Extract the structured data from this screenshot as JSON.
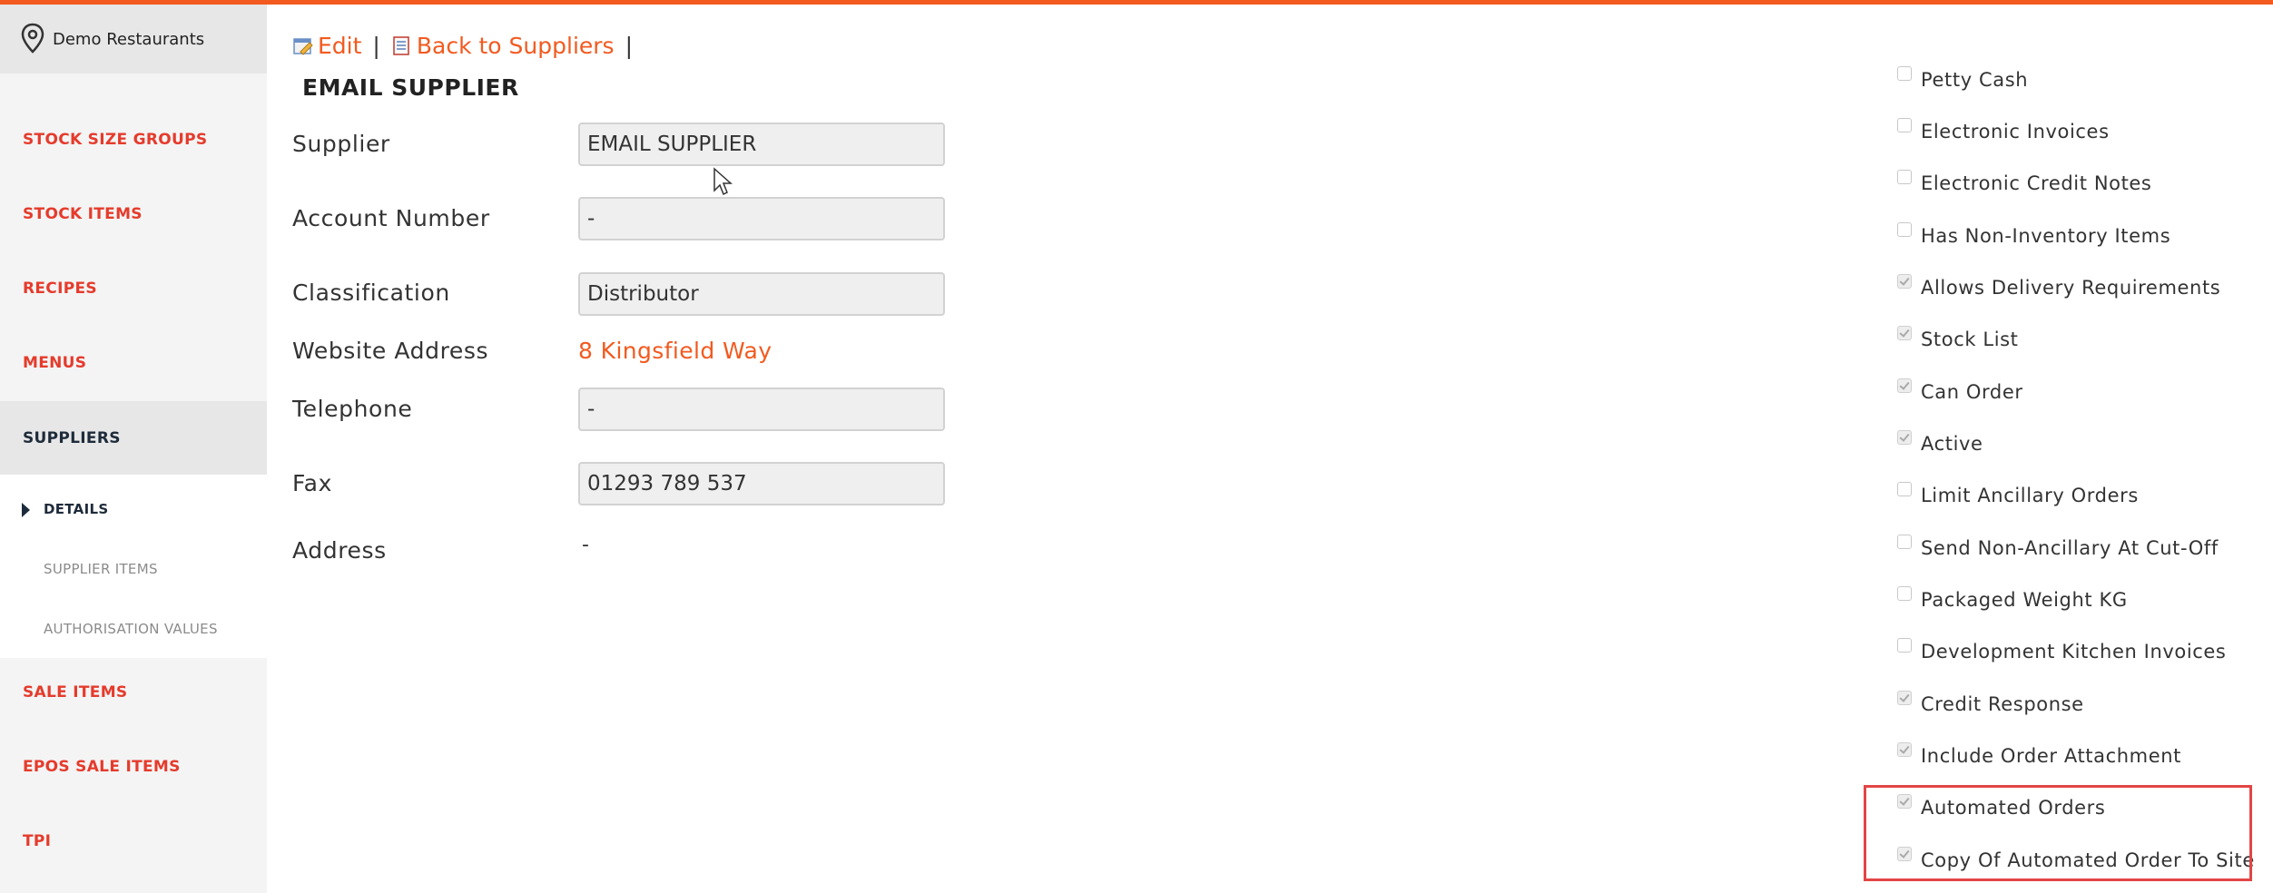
{
  "sidebar": {
    "restaurant_name": "Demo Restaurants",
    "items": [
      {
        "label": "STOCK SIZE GROUPS"
      },
      {
        "label": "STOCK ITEMS"
      },
      {
        "label": "RECIPES"
      },
      {
        "label": "MENUS"
      },
      {
        "label": "SUPPLIERS",
        "active": true
      },
      {
        "label": "SALE ITEMS"
      },
      {
        "label": "EPOS SALE ITEMS"
      },
      {
        "label": "TPI"
      }
    ],
    "subitems": [
      {
        "label": "DETAILS",
        "active": true
      },
      {
        "label": "SUPPLIER ITEMS"
      },
      {
        "label": "AUTHORISATION VALUES"
      }
    ]
  },
  "toolbar": {
    "edit_label": "Edit",
    "back_label": "Back to Suppliers",
    "separator": "|"
  },
  "page_title": "EMAIL SUPPLIER",
  "form": {
    "supplier": {
      "label": "Supplier",
      "value": "EMAIL SUPPLIER"
    },
    "account_number": {
      "label": "Account Number",
      "value": "-"
    },
    "classification": {
      "label": "Classification",
      "value": "Distributor"
    },
    "website": {
      "label": "Website Address",
      "value": "8 Kingsfield Way"
    },
    "telephone": {
      "label": "Telephone",
      "value": "-"
    },
    "fax": {
      "label": "Fax",
      "value": "01293 789 537"
    },
    "address": {
      "label": "Address",
      "value": "-"
    }
  },
  "options": [
    {
      "label": "Petty Cash",
      "checked": false
    },
    {
      "label": "Electronic Invoices",
      "checked": false
    },
    {
      "label": "Electronic Credit Notes",
      "checked": false
    },
    {
      "label": "Has Non-Inventory Items",
      "checked": false
    },
    {
      "label": "Allows Delivery Requirements",
      "checked": true
    },
    {
      "label": "Stock List",
      "checked": true
    },
    {
      "label": "Can Order",
      "checked": true
    },
    {
      "label": "Active",
      "checked": true
    },
    {
      "label": "Limit Ancillary Orders",
      "checked": false
    },
    {
      "label": "Send Non-Ancillary At Cut-Off",
      "checked": false
    },
    {
      "label": "Packaged Weight KG",
      "checked": false
    },
    {
      "label": "Development Kitchen Invoices",
      "checked": false
    },
    {
      "label": "Credit Response",
      "checked": true
    },
    {
      "label": "Include Order Attachment",
      "checked": true
    },
    {
      "label": "Automated Orders",
      "checked": true
    },
    {
      "label": "Copy Of Automated Order To Site",
      "checked": true
    }
  ],
  "colors": {
    "accent": "#f25a1f",
    "nav_text": "#e53b2c",
    "highlight_border": "#e34545"
  }
}
